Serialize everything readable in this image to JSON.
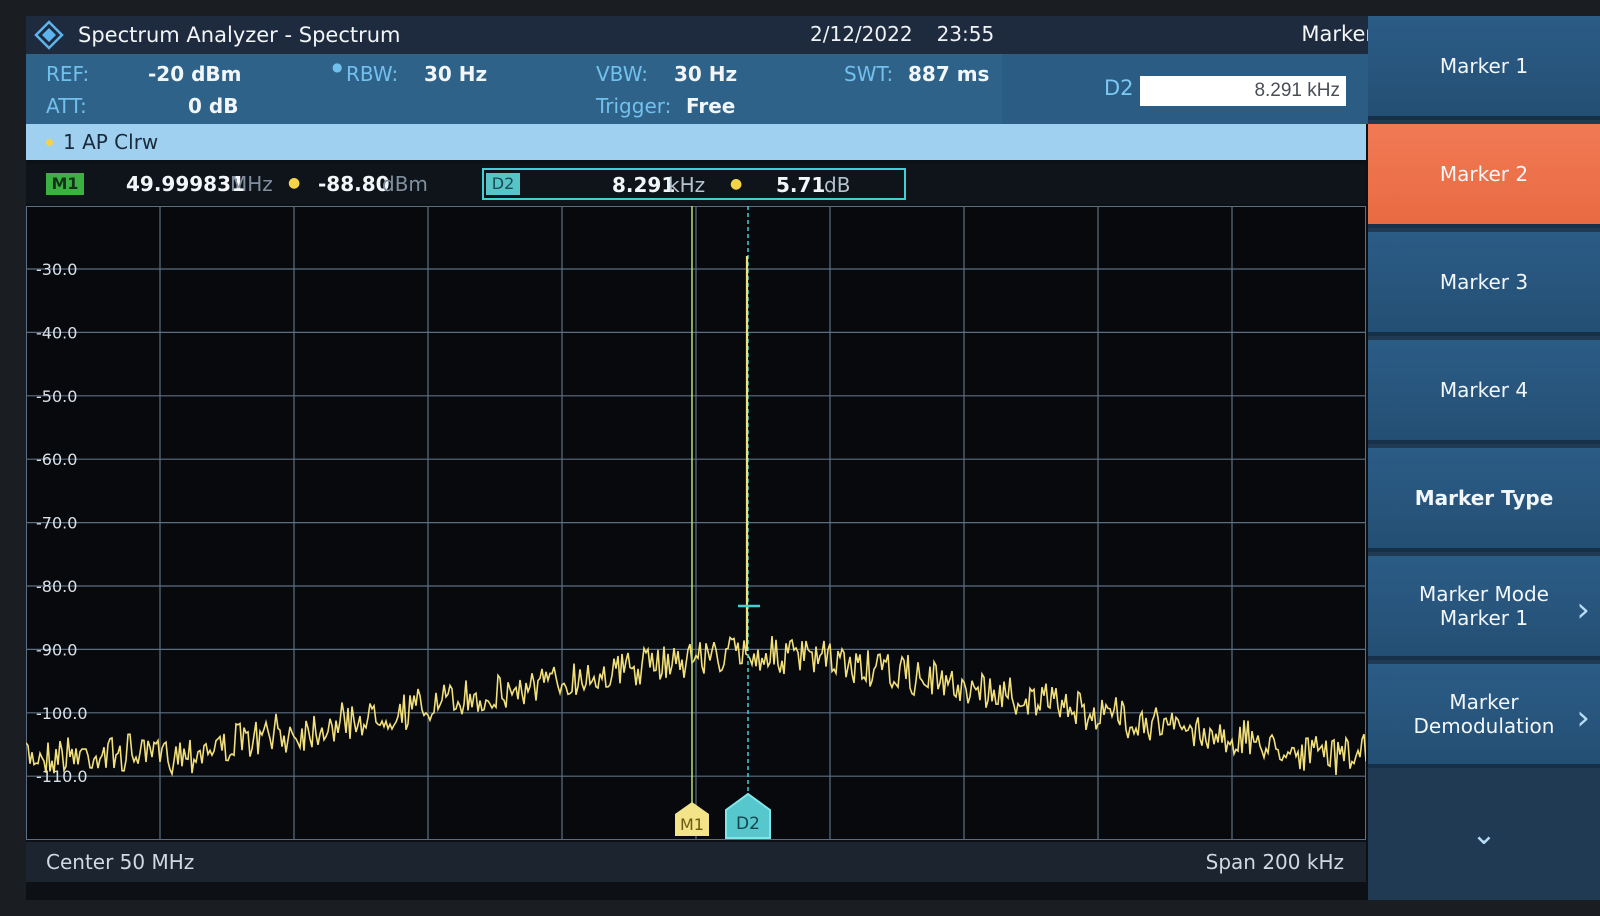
{
  "titlebar": {
    "app_title": "Spectrum Analyzer - Spectrum",
    "date": "2/12/2022",
    "time": "23:55",
    "menu_title": "Marker"
  },
  "params": {
    "ref_label": "REF:",
    "ref_value": "-20 dBm",
    "att_label": "ATT:",
    "att_value": "0 dB",
    "rbw_label": "RBW:",
    "rbw_value": "30 Hz",
    "vbw_label": "VBW:",
    "vbw_value": "30 Hz",
    "trigger_label": "Trigger:",
    "trigger_value": "Free",
    "swt_label": "SWT:",
    "swt_value": "887 ms",
    "d2_label": "D2",
    "d2_input": "8.291 kHz"
  },
  "trace": {
    "label": "1 AP  Clrw"
  },
  "markers": {
    "m1_badge": "M1",
    "m1_freq": "49.999831",
    "m1_freq_unit": "MHz",
    "m1_level": "-88.80",
    "m1_level_unit": "dBm",
    "d2_badge": "D2",
    "d2_freq": "8.291",
    "d2_freq_unit": "kHz",
    "d2_delta": "5.71",
    "d2_delta_unit": "dB"
  },
  "plot": {
    "y_ticks": [
      "-30.0",
      "-40.0",
      "-50.0",
      "-60.0",
      "-70.0",
      "-80.0",
      "-90.0",
      "-100.0",
      "-110.0"
    ],
    "m1_flag": "M1",
    "d2_flag": "D2",
    "trace_color": "#f2e07a",
    "m1_color": "#b8e07a",
    "d2_color": "#3fd1d6"
  },
  "footer": {
    "center": "Center 50 MHz",
    "span": "Span 200 kHz"
  },
  "softkeys": {
    "marker1": "Marker 1",
    "marker2": "Marker 2",
    "marker3": "Marker 3",
    "marker4": "Marker 4",
    "marker_type": "Marker Type",
    "marker_mode_l1": "Marker Mode",
    "marker_mode_l2": "Marker 1",
    "marker_demod_l1": "Marker",
    "marker_demod_l2": "Demodulation"
  }
}
